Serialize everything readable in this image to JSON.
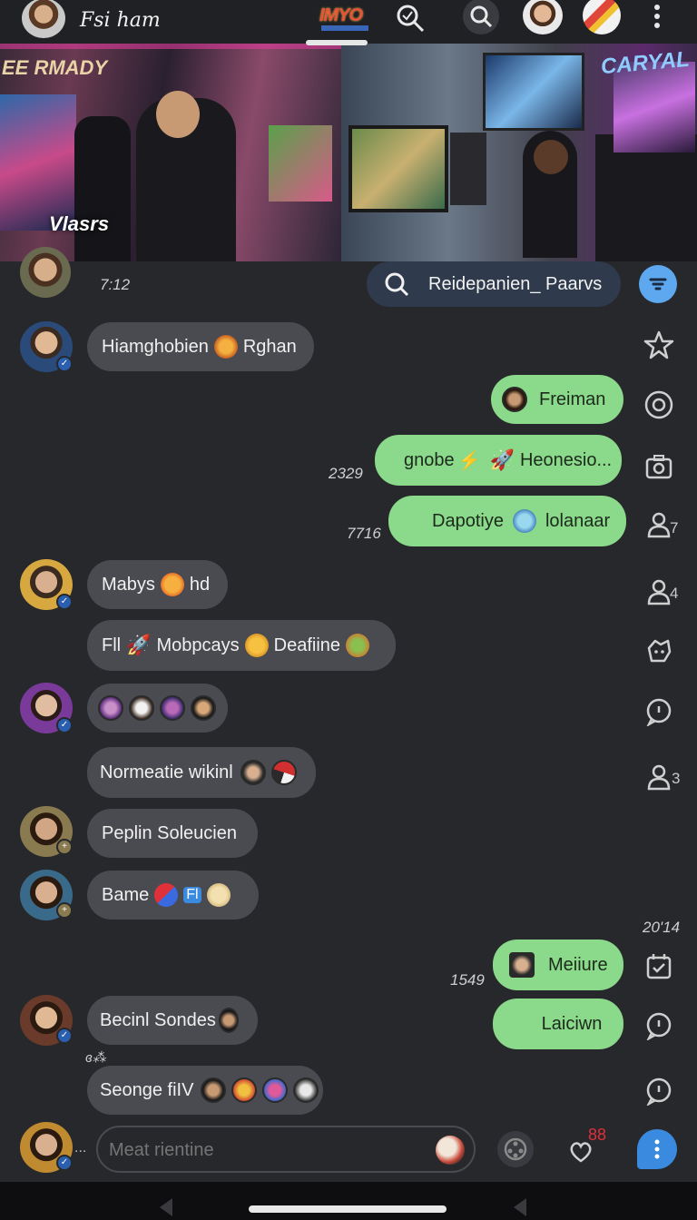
{
  "topbar": {
    "title": "Fsi ham",
    "brand": "IMYO",
    "brand_sub": "ЖЖЖЖЖЖ"
  },
  "banner": {
    "left_label": "EE RMADY",
    "caption": "Vlasrs",
    "right_label": "CARYAL"
  },
  "search": {
    "label": "Reidepanien_ Paarvs"
  },
  "first_time": "7:12",
  "messages": [
    {
      "id": "m1",
      "dir": "in",
      "text": "Hiamghobien",
      "text2": "Rghan"
    },
    {
      "id": "m2",
      "dir": "out",
      "text": "Freiman"
    },
    {
      "id": "m3",
      "dir": "out",
      "time": "2329",
      "text": "gnobe",
      "text2": "Heonesio..."
    },
    {
      "id": "m4",
      "dir": "out",
      "time": "7716",
      "text": "Dapotiye",
      "text2": "lolanaar"
    },
    {
      "id": "m5",
      "dir": "in",
      "text": "Mabys",
      "text2": "hd"
    },
    {
      "id": "m6",
      "dir": "in",
      "text": "Fll",
      "text2": "Mobpcays",
      "text3": "Deafiine"
    },
    {
      "id": "m7",
      "dir": "in",
      "text": ""
    },
    {
      "id": "m8",
      "dir": "in",
      "text": "Normeatie wikinl"
    },
    {
      "id": "m9",
      "dir": "in",
      "text": "Peplin Soleucien"
    },
    {
      "id": "m10",
      "dir": "in",
      "text": "Bame",
      "text2": "Fl"
    },
    {
      "id": "m11",
      "dir": "out",
      "time": "1549",
      "text": "Meiiure"
    },
    {
      "id": "m12",
      "dir": "out",
      "text": "Laiciwn"
    },
    {
      "id": "m13",
      "dir": "in",
      "text": "Becinl Sondes"
    },
    {
      "id": "m14",
      "dir": "in",
      "text": "Seonge fiIV"
    }
  ],
  "time_2014": "20'14",
  "time_dots": "ɞ⁂",
  "side_nums": {
    "a": "7",
    "b": "4",
    "c": "3"
  },
  "composer": {
    "placeholder": "Meat rientine",
    "dots": "..."
  },
  "bottom": {
    "notif_count": "88"
  },
  "colors": {
    "bubble_out": "#8bd98a",
    "bubble_in": "#4a4b50",
    "accent": "#5ea8f0"
  }
}
